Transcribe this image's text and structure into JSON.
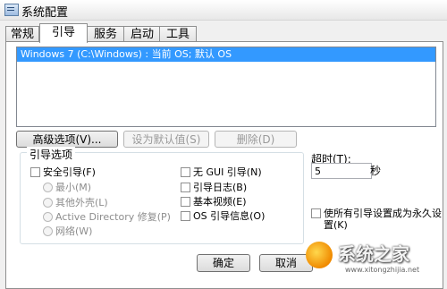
{
  "window": {
    "title": "系统配置"
  },
  "tabs": [
    {
      "label": "常规",
      "active": false
    },
    {
      "label": "引导",
      "active": true
    },
    {
      "label": "服务",
      "active": false
    },
    {
      "label": "启动",
      "active": false
    },
    {
      "label": "工具",
      "active": false
    }
  ],
  "boot_list": {
    "entries": [
      {
        "text": "Windows 7 (C:\\Windows) : 当前 OS; 默认 OS",
        "selected": true
      }
    ]
  },
  "buttons": {
    "advanced": "高级选项(V)...",
    "set_default": "设为默认值(S)",
    "delete": "删除(D)",
    "ok": "确定",
    "cancel": "取消"
  },
  "boot_options": {
    "legend": "引导选项",
    "safe_boot": "安全引导(F)",
    "minimal": "最小(M)",
    "alternate_shell": "其他外壳(L)",
    "active_directory_repair": "Active Directory 修复(P)",
    "network": "网络(W)",
    "no_gui_boot": "无 GUI 引导(N)",
    "boot_log": "引导日志(B)",
    "base_video": "基本视频(E)",
    "os_boot_info": "OS 引导信息(O)"
  },
  "timeout": {
    "label": "超时(T):",
    "value": "5",
    "unit": "秒"
  },
  "persist": {
    "label": "使所有引导设置成为永久设置(K)",
    "checked": false
  },
  "watermark": {
    "text": "系统之家",
    "url": "www.xitongzhijia.net"
  },
  "colors": {
    "selection": "#3399ff",
    "window_bg": "#f0f0f0"
  }
}
